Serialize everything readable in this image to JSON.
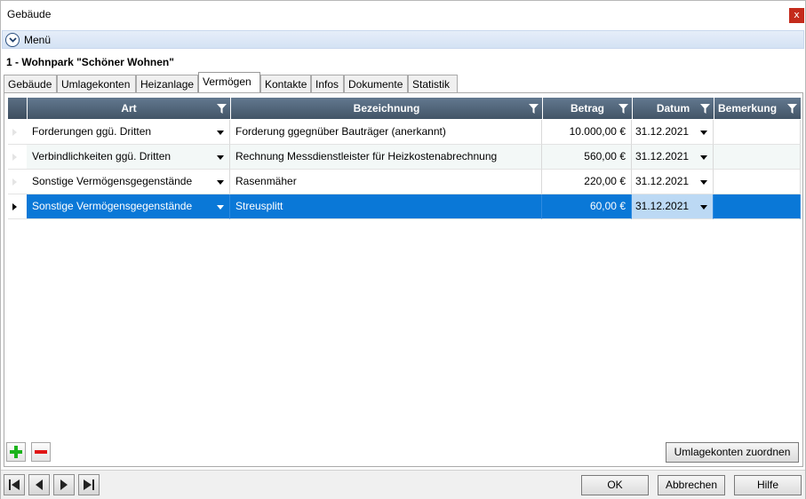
{
  "window": {
    "title": "Gebäude",
    "close_label": "x"
  },
  "menu": {
    "label": "Menü"
  },
  "entity_title": "1 - Wohnpark \"Schöner Wohnen\"",
  "tabs": [
    {
      "label": "Gebäude"
    },
    {
      "label": "Umlagekonten"
    },
    {
      "label": "Heizanlage"
    },
    {
      "label": "Vermögen"
    },
    {
      "label": "Kontakte"
    },
    {
      "label": "Infos"
    },
    {
      "label": "Dokumente"
    },
    {
      "label": "Statistik"
    }
  ],
  "active_tab": "Vermögen",
  "grid": {
    "columns": [
      {
        "label": "Art"
      },
      {
        "label": "Bezeichnung"
      },
      {
        "label": "Betrag"
      },
      {
        "label": "Datum"
      },
      {
        "label": "Bemerkung"
      }
    ],
    "rows": [
      {
        "art": "Forderungen ggü. Dritten",
        "bezeichnung": "Forderung ggegnüber Bauträger (anerkannt)",
        "betrag": "10.000,00 €",
        "datum": "31.12.2021",
        "bemerkung": ""
      },
      {
        "art": "Verbindlichkeiten ggü. Dritten",
        "bezeichnung": "Rechnung Messdienstleister für Heizkostenabrechnung",
        "betrag": "560,00 €",
        "datum": "31.12.2021",
        "bemerkung": ""
      },
      {
        "art": "Sonstige Vermögensgegenstände",
        "bezeichnung": "Rasenmäher",
        "betrag": "220,00 €",
        "datum": "31.12.2021",
        "bemerkung": ""
      },
      {
        "art": "Sonstige Vermögensgegenstände",
        "bezeichnung": "Streusplitt",
        "betrag": "60,00 €",
        "datum": "31.12.2021",
        "bemerkung": ""
      }
    ],
    "selected_row": 3
  },
  "buttons": {
    "add_icon": "plus-icon",
    "remove_icon": "minus-icon",
    "assign_label": "Umlagekonten zuordnen",
    "ok_label": "OK",
    "cancel_label": "Abbrechen",
    "help_label": "Hilfe"
  },
  "colors": {
    "header_bg": "#4d6177",
    "selection": "#0a78d7",
    "add_green": "#1bb31b",
    "remove_red": "#e01515"
  }
}
